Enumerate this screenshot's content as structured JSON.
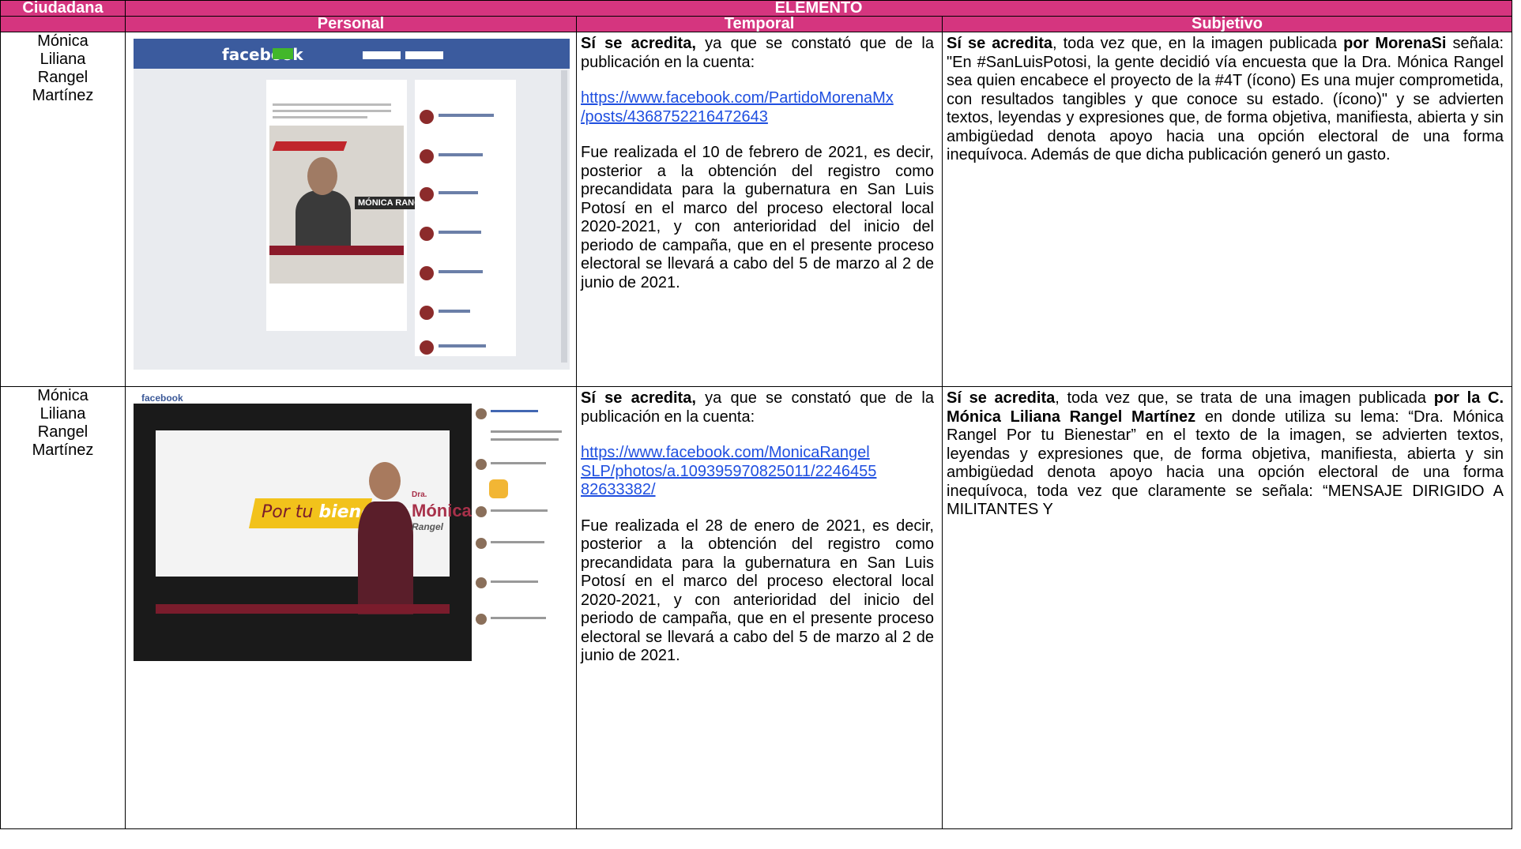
{
  "headers": {
    "col1": "Ciudadana",
    "element": "ELEMENTO",
    "personal": "Personal",
    "temporal": "Temporal",
    "subjetivo": "Subjetivo"
  },
  "rows": [
    {
      "name": [
        "Mónica",
        "Liliana",
        "Rangel",
        "Martínez"
      ],
      "image": {
        "brand": "facebook",
        "candidate_banner": "MÓNICA RANGEL"
      },
      "temporal": {
        "lead_bold": "Sí se acredita,",
        "lead_rest": " ya que se constató que de la publicación en la cuenta:",
        "url_part1": "https://www.facebook.com/PartidoMorenaMx",
        "url_part2": "/posts/4368752216472643",
        "body": "Fue realizada el 10 de febrero de 2021, es decir, posterior a la obtención del registro como precandidata para la gubernatura en San Luis Potosí en el marco del proceso electoral local 2020-2021, y con anterioridad del inicio del periodo de campaña, que en el presente proceso electoral se llevará a cabo del 5 de marzo al 2 de junio de 2021."
      },
      "subjetivo": {
        "b1": "Sí se acredita",
        "t1": ", toda vez que, en la imagen publicada ",
        "b2": "por MorenaSi",
        "t2": " señala: \"En #SanLuisPotosi, la gente decidió vía encuesta que la Dra. Mónica Rangel sea quien encabece el proyecto de la #4T (ícono) Es una mujer comprometida, con resultados tangibles y que conoce su estado. (ícono)\" y se advierten textos, leyendas y expresiones que, de forma objetiva, manifiesta, abierta y sin ambigüedad denota apoyo hacia una opción electoral de una forma inequívoca. Además de que dicha publicación generó un gasto."
      }
    },
    {
      "name": [
        "Mónica",
        "Liliana",
        "Rangel",
        "Martínez"
      ],
      "image": {
        "brand": "facebook",
        "slogan_a": "Por tu ",
        "slogan_b": "bienestar",
        "dra": "Dra.",
        "first": "Mónica",
        "last": "Rangel"
      },
      "temporal": {
        "lead_bold": "Sí se acredita,",
        "lead_rest": " ya que se constató que de la publicación en la cuenta:",
        "url_part1": "https://www.facebook.com/MonicaRangel",
        "url_part2": "SLP/photos/a.109395970825011/2246455",
        "url_part3": "82633382/",
        "body": "Fue realizada el 28 de enero de 2021, es decir, posterior a la obtención del registro como precandidata para la gubernatura en San Luis Potosí en el marco del proceso electoral local 2020-2021, y con anterioridad del inicio del periodo de campaña, que en el presente proceso electoral se llevará a cabo del 5 de marzo al 2 de junio de 2021."
      },
      "subjetivo": {
        "b1": "Sí se acredita",
        "t1": ", toda vez que, se trata de una imagen publicada ",
        "b2": "por la C. Mónica Liliana Rangel Martínez",
        "t2": " en donde utiliza su lema: “Dra. Mónica Rangel Por tu Bienestar” en el texto de la imagen, se advierten textos, leyendas y expresiones que, de forma objetiva, manifiesta, abierta y sin ambigüedad denota apoyo hacia una opción electoral de una forma inequívoca, toda vez que claramente se señala: “MENSAJE DIRIGIDO A MILITANTES Y"
      }
    }
  ]
}
